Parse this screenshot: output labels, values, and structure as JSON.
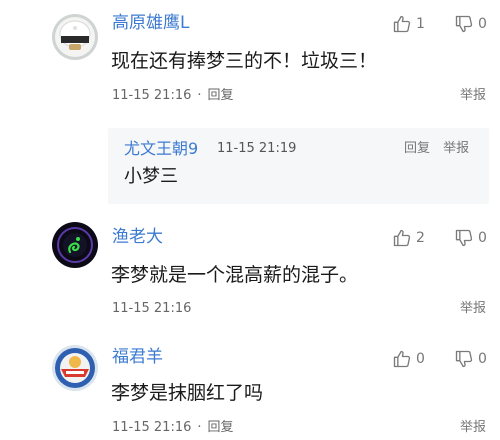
{
  "comments": [
    {
      "username": "高原雄鹰L",
      "content": "现在还有捧梦三的不！垃圾三！",
      "timestamp": "11-15 21:16",
      "reply_label": "回复",
      "report_label": "举报",
      "likes": "1",
      "dislikes": "0",
      "avatar_icon": "white-round-device-avatar",
      "reply": {
        "username": "尤文王朝9",
        "timestamp": "11-15 21:19",
        "content": "小梦三",
        "reply_label": "回复",
        "report_label": "举报"
      }
    },
    {
      "username": "渔老大",
      "content": "李梦就是一个混高薪的混子。",
      "timestamp": "11-15 21:16",
      "report_label": "举报",
      "likes": "2",
      "dislikes": "0",
      "avatar_icon": "dark-snake-logo-avatar"
    },
    {
      "username": "福君羊",
      "content": "李梦是抹胭红了吗",
      "timestamp": "11-15 21:16",
      "reply_label": "回复",
      "report_label": "举报",
      "likes": "0",
      "dislikes": "0",
      "avatar_icon": "colorful-badge-avatar"
    }
  ],
  "colors": {
    "username": "#3c7bd0",
    "text": "#1a1a1a",
    "meta": "#666666",
    "reply_bg": "#f6f7f9"
  },
  "icons": {
    "like": "thumbs-up-icon",
    "dislike": "thumbs-down-icon"
  }
}
